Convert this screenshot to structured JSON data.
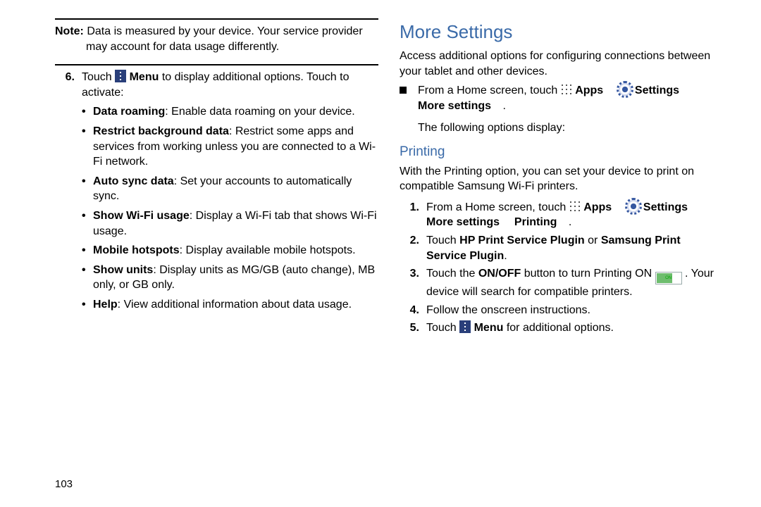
{
  "left": {
    "note_label": "Note:",
    "note_line1": " Data is measured by your device. Your service provider",
    "note_line2": "may account for data usage differently.",
    "step6_num": "6.",
    "step6_a": "Touch ",
    "step6_menu": " Menu",
    "step6_b": " to display additional options. Touch to activate:",
    "items": [
      {
        "term": "Data roaming",
        "desc": ": Enable data roaming on your device."
      },
      {
        "term": "Restrict background data",
        "desc": ": Restrict some apps and services from working unless you are connected to a Wi-Fi network."
      },
      {
        "term": "Auto sync data",
        "desc": ": Set your accounts to automatically sync."
      },
      {
        "term": "Show Wi-Fi usage",
        "desc": ": Display a Wi-Fi tab that shows Wi-Fi usage."
      },
      {
        "term": "Mobile hotspots",
        "desc": ": Display available mobile hotspots."
      },
      {
        "term": "Show units",
        "desc": ": Display units as MG/GB (auto change), MB only, or GB only."
      },
      {
        "term": "Help",
        "desc": ": View additional information about data usage."
      }
    ]
  },
  "right": {
    "h_more": "More Settings",
    "more_desc": "Access additional options for configuring connections between your tablet and other devices.",
    "from_home": "From a Home screen, touch ",
    "apps": " Apps",
    "settings": " Settings",
    "more_settings": "More settings",
    "period": ".",
    "following": "The following options display:",
    "h_print": "Printing",
    "print_desc": "With the Printing option, you can set your device to print on compatible Samsung Wi-Fi printers.",
    "s1_num": "1.",
    "s1_a": "From a Home screen, touch ",
    "printing": "Printing",
    "s2_num": "2.",
    "s2_a": "Touch ",
    "s2_b": "HP Print Service Plugin",
    "s2_c": " or ",
    "s2_d": "Samsung Print Service Plugin",
    "s3_num": "3.",
    "s3_a": "Touch the ",
    "s3_b": "ON/OFF",
    "s3_c": " button to turn Printing ON ",
    "on": "ON",
    "s3_d": ". Your device will search for compatible printers.",
    "s4_num": "4.",
    "s4": "Follow the onscreen instructions.",
    "s5_num": "5.",
    "s5_a": "Touch ",
    "s5_menu": " Menu",
    "s5_b": " for additional options."
  },
  "page_number": "103"
}
